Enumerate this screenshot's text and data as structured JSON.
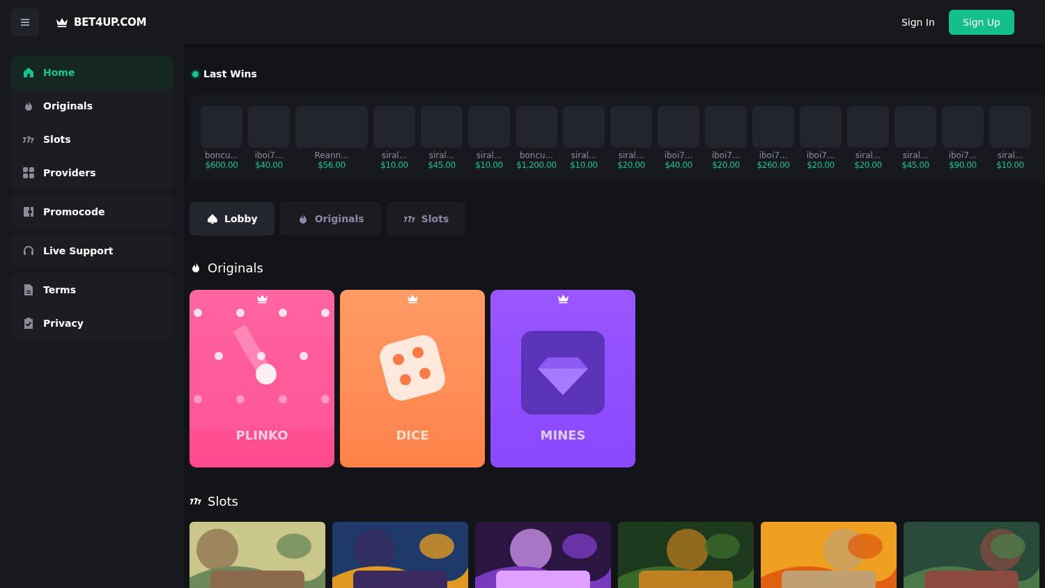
{
  "header": {
    "logo": "BET4UP.COM",
    "sign_in": "Sign In",
    "sign_up": "Sign Up"
  },
  "sidebar": {
    "groups": [
      [
        {
          "label": "Home",
          "selected": true
        },
        {
          "label": "Originals",
          "selected": false
        },
        {
          "label": "Slots",
          "selected": false
        },
        {
          "label": "Providers",
          "selected": false
        }
      ],
      [
        {
          "label": "Promocode",
          "selected": false
        }
      ],
      [
        {
          "label": "Live Support",
          "selected": false
        }
      ],
      [
        {
          "label": "Terms",
          "selected": false
        },
        {
          "label": "Privacy",
          "selected": false
        }
      ]
    ]
  },
  "last_wins": {
    "title": "Last Wins",
    "items": [
      {
        "user": "boncu...",
        "amount": "$600.00",
        "kind": "square"
      },
      {
        "user": "iboi7...",
        "amount": "$40.00",
        "kind": "square"
      },
      {
        "user": "Reann...",
        "amount": "$56.00",
        "kind": "wide"
      },
      {
        "user": "siral...",
        "amount": "$10.00",
        "kind": "square"
      },
      {
        "user": "siral...",
        "amount": "$45.00",
        "kind": "square"
      },
      {
        "user": "siral...",
        "amount": "$10.00",
        "kind": "square"
      },
      {
        "user": "boncu...",
        "amount": "$1,200.00",
        "kind": "square"
      },
      {
        "user": "siral...",
        "amount": "$10.00",
        "kind": "square"
      },
      {
        "user": "siral...",
        "amount": "$20.00",
        "kind": "square"
      },
      {
        "user": "iboi7...",
        "amount": "$40.00",
        "kind": "square"
      },
      {
        "user": "iboi7...",
        "amount": "$20.00",
        "kind": "square"
      },
      {
        "user": "iboi7...",
        "amount": "$260.00",
        "kind": "square"
      },
      {
        "user": "iboi7...",
        "amount": "$20.00",
        "kind": "square"
      },
      {
        "user": "siral...",
        "amount": "$20.00",
        "kind": "square"
      },
      {
        "user": "siral...",
        "amount": "$45.00",
        "kind": "square"
      },
      {
        "user": "iboi7...",
        "amount": "$90.00",
        "kind": "square"
      },
      {
        "user": "siral...",
        "amount": "$10.00",
        "kind": "square"
      }
    ]
  },
  "tabs": [
    {
      "label": "Lobby",
      "selected": true
    },
    {
      "label": "Originals",
      "selected": false
    },
    {
      "label": "Slots",
      "selected": false
    }
  ],
  "originals": {
    "title": "Originals",
    "games": [
      {
        "name": "PLINKO",
        "kind": "plinko"
      },
      {
        "name": "DICE",
        "kind": "dice"
      },
      {
        "name": "MINES",
        "kind": "mines"
      }
    ]
  },
  "slots": {
    "title": "Slots"
  }
}
